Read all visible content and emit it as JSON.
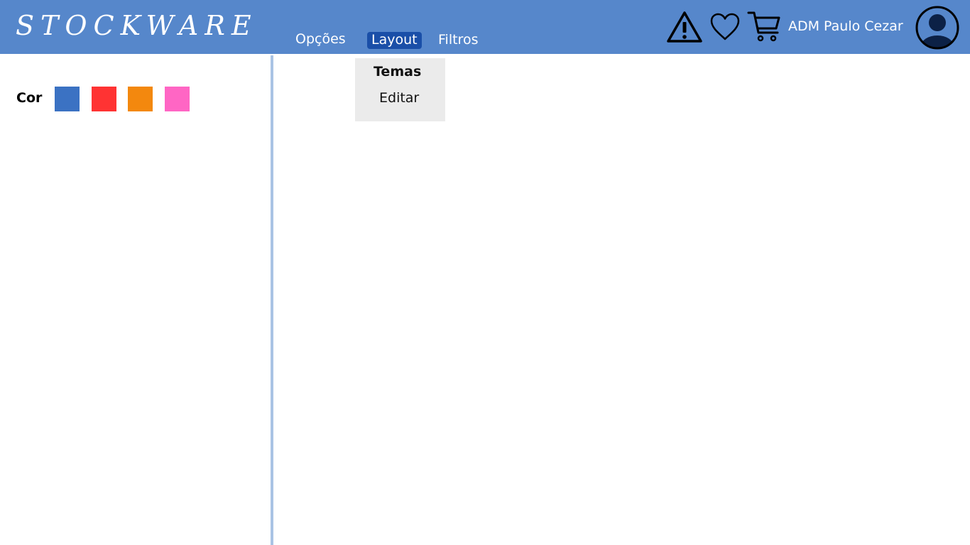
{
  "app": {
    "brand": "STOCKWARE"
  },
  "nav": {
    "items": [
      {
        "label": "Opções",
        "active": false
      },
      {
        "label": "Layout",
        "active": true
      },
      {
        "label": "Filtros",
        "active": false
      }
    ]
  },
  "header": {
    "icons": [
      "warning-icon",
      "heart-icon",
      "cart-icon"
    ],
    "user_name": "ADM Paulo Cezar",
    "avatar_icon": "user-avatar-icon"
  },
  "dropdown": {
    "items": [
      {
        "label": "Temas",
        "bold": true
      },
      {
        "label": "Editar",
        "bold": false
      }
    ]
  },
  "sidebar": {
    "color_label": "Cor",
    "swatches": [
      {
        "color": "#3b72c3"
      },
      {
        "color": "#ff3333"
      },
      {
        "color": "#f3880e"
      },
      {
        "color": "#ff66c4"
      }
    ]
  },
  "theme": {
    "header_bg": "#5687cb",
    "active_tab_bg": "#1a4fa8",
    "divider": "#a9c3e4",
    "dropdown_bg": "#ebebeb",
    "avatar_fill": "#0c2146"
  }
}
